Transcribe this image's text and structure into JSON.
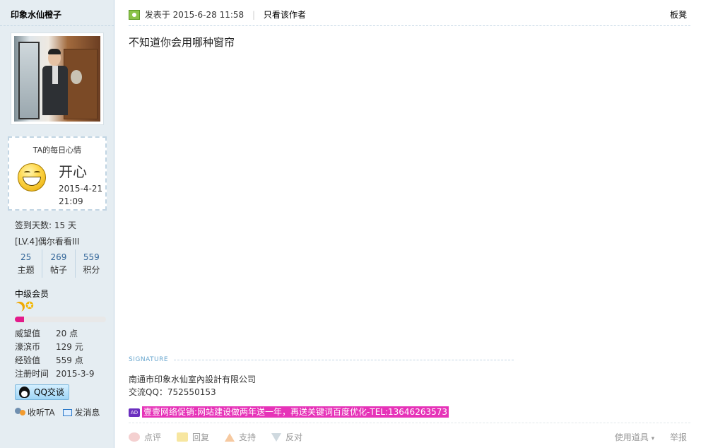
{
  "sidebar": {
    "username": "印象水仙橙子",
    "mood": {
      "title": "TA的每日心情",
      "word": "开心",
      "date": "2015-4-21",
      "time": "21:09",
      "icon": "laughing-face-icon"
    },
    "sign_days": "签到天数: 15 天",
    "level": "[LV.4]偶尔看看III",
    "stats": [
      {
        "value": "25",
        "label": "主题"
      },
      {
        "value": "269",
        "label": "帖子"
      },
      {
        "value": "559",
        "label": "积分"
      }
    ],
    "group": "中级会员",
    "progress": 0.1,
    "info": [
      {
        "key": "威望值",
        "value": "20 点"
      },
      {
        "key": "濠滨币",
        "value": "129 元"
      },
      {
        "key": "经验值",
        "value": "559 点"
      },
      {
        "key": "注册时间",
        "value": "2015-3-9"
      }
    ],
    "qq_button": "QQ交谈",
    "follow": "收听TA",
    "message": "发消息"
  },
  "post": {
    "posted_label": "发表于",
    "posted_time": "2015-6-28 11:58",
    "author_only": "只看该作者",
    "floor": "板凳",
    "content": "不知道你会用哪种窗帘",
    "signature_label": "SIGNATURE",
    "signature_lines": [
      "南通市印象水仙室內設計有限公司",
      "交流QQ：752550153"
    ],
    "ad_tag": "AD",
    "ad_text": "壹壹网络促销:网站建设做两年送一年，再送关键词百度优化-TEL:13646263573",
    "actions": [
      "点评",
      "回复",
      "支持",
      "反对"
    ],
    "tools": [
      "使用道具",
      "举报"
    ]
  },
  "colors": {
    "sidebar_bg": "#e5edf2",
    "accent_blue": "#336699",
    "ad_pink": "#e633b8",
    "progress_pink": "#e31b8a"
  }
}
